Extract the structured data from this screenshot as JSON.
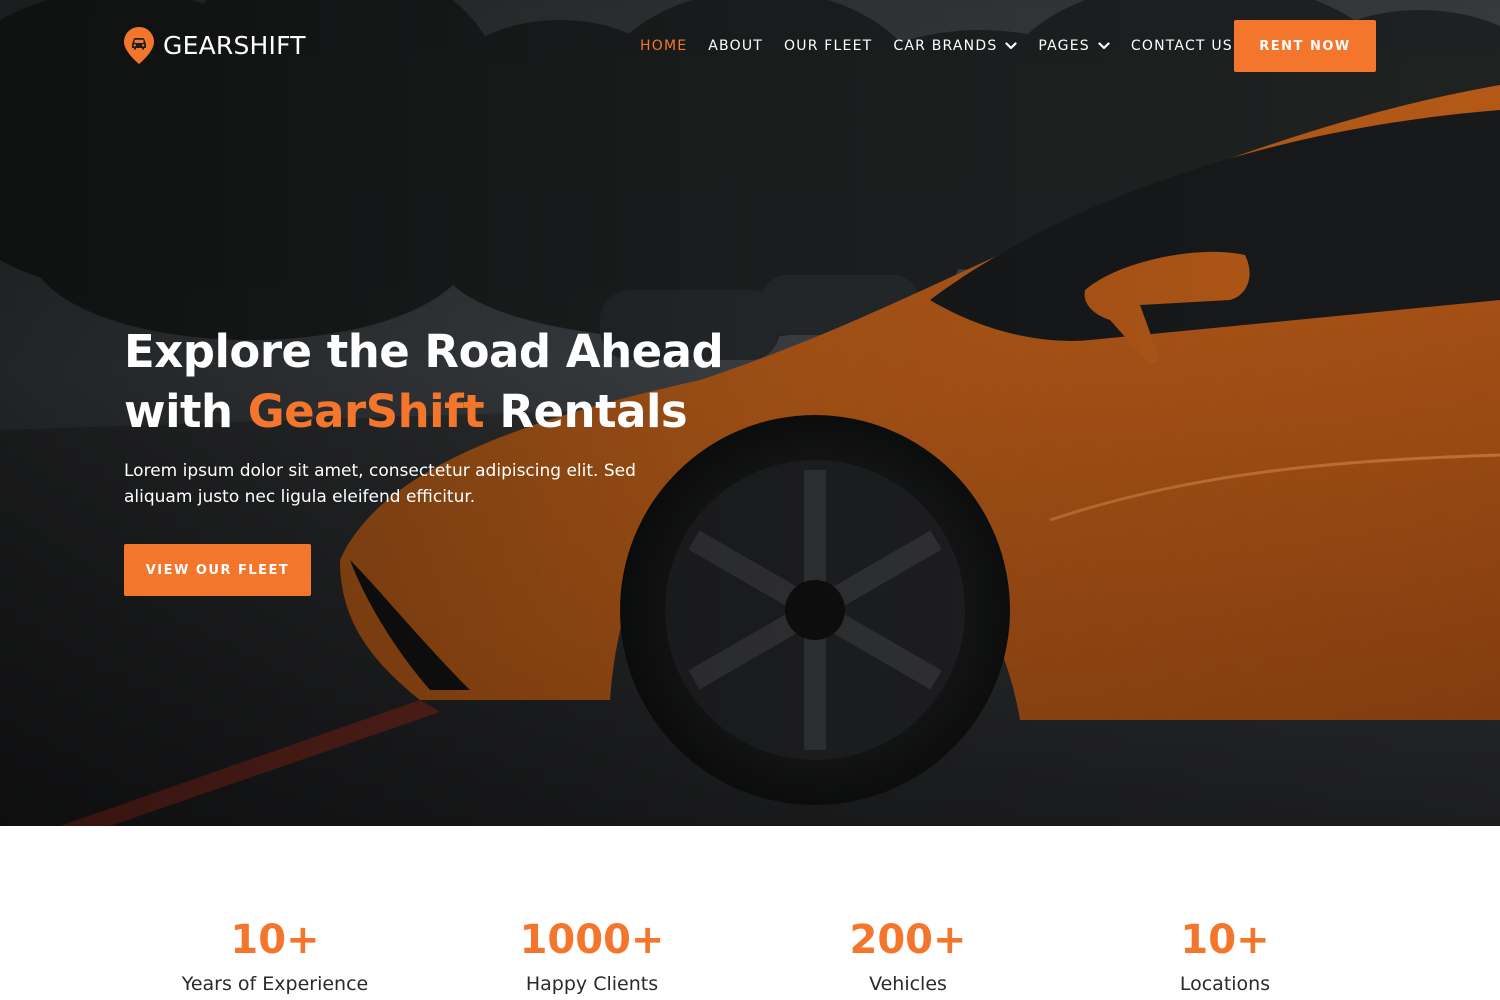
{
  "brand": {
    "name": "GEARSHIFT",
    "logo_icon": "car-pin-icon",
    "accent_color": "#f4762c"
  },
  "nav": {
    "items": [
      {
        "label": "HOME",
        "active": true,
        "dropdown": false
      },
      {
        "label": "ABOUT",
        "active": false,
        "dropdown": false
      },
      {
        "label": "OUR FLEET",
        "active": false,
        "dropdown": false
      },
      {
        "label": "CAR BRANDS",
        "active": false,
        "dropdown": true
      },
      {
        "label": "PAGES",
        "active": false,
        "dropdown": true
      },
      {
        "label": "CONTACT US",
        "active": false,
        "dropdown": false
      }
    ],
    "cta_label": "RENT NOW"
  },
  "hero": {
    "title_line1": "Explore the Road Ahead",
    "title_with": "with",
    "title_accent": "GearShift",
    "title_end": "Rentals",
    "description": "Lorem ipsum dolor sit amet, consectetur adipiscing elit. Sed aliquam justo nec ligula eleifend efficitur.",
    "button_label": "VIEW OUR FLEET"
  },
  "stats": [
    {
      "value": "10+",
      "label": "Years of Experience"
    },
    {
      "value": "1000+",
      "label": "Happy Clients"
    },
    {
      "value": "200+",
      "label": "Vehicles"
    },
    {
      "value": "10+",
      "label": "Locations"
    }
  ]
}
